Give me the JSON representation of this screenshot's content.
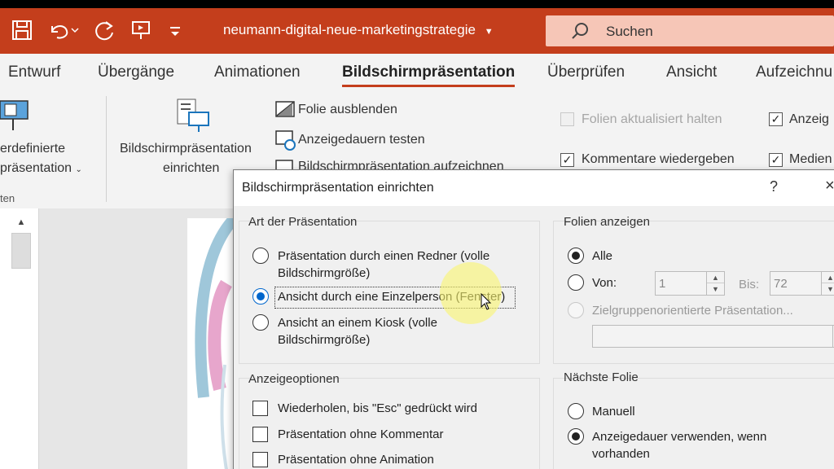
{
  "titlebar": {
    "doc_title": "neumann-digital-neue-marketingstrategie",
    "search_label": "Suchen",
    "icons": [
      "save-icon",
      "undo-icon",
      "redo-icon",
      "present-icon",
      "customize-icon"
    ]
  },
  "ribbon": {
    "tabs": [
      "Entwurf",
      "Übergänge",
      "Animationen",
      "Bildschirmpräsentation",
      "Überprüfen",
      "Ansicht",
      "Aufzeichnu"
    ],
    "custom_show_line1": "erdefinierte",
    "custom_show_line2": "präsentation",
    "group_label": "ten",
    "setup_line1": "Bildschirmpräsentation",
    "setup_line2": "einrichten",
    "hide_slide": "Folie ausblenden",
    "rehearse": "Anzeigedauern testen",
    "record": "Bildschirmpräsentation aufzeichnen",
    "keep_updated": "Folien aktualisiert halten",
    "play_comments": "Kommentare wiedergeben",
    "show_timings": "Anzeig",
    "show_media": "Medien"
  },
  "dialog": {
    "title": "Bildschirmpräsentation einrichten",
    "help": "?",
    "close": "×",
    "type_group": "Art der Präsentation",
    "type_opt1_line1": "Präsentation durch einen Redner (volle",
    "type_opt1_line2": "Bildschirmgröße)",
    "type_opt2": "Ansicht durch eine Einzelperson (Fenster)",
    "type_opt3_line1": "Ansicht an einem Kiosk (volle",
    "type_opt3_line2": "Bildschirmgröße)",
    "slides_group": "Folien anzeigen",
    "slides_all": "Alle",
    "slides_from": "Von:",
    "from_value": "1",
    "slides_to": "Bis:",
    "to_value": "72",
    "custom_show": "Zielgruppenorientierte Präsentation...",
    "options_group": "Anzeigeoptionen",
    "opt_loop": "Wiederholen, bis \"Esc\" gedrückt wird",
    "opt_no_narration": "Präsentation ohne Kommentar",
    "opt_no_animation": "Präsentation ohne Animation",
    "advance_group": "Nächste Folie",
    "advance_manual": "Manuell",
    "advance_timings_line1": "Anzeigedauer verwenden, wenn",
    "advance_timings_line2": "vorhanden"
  }
}
